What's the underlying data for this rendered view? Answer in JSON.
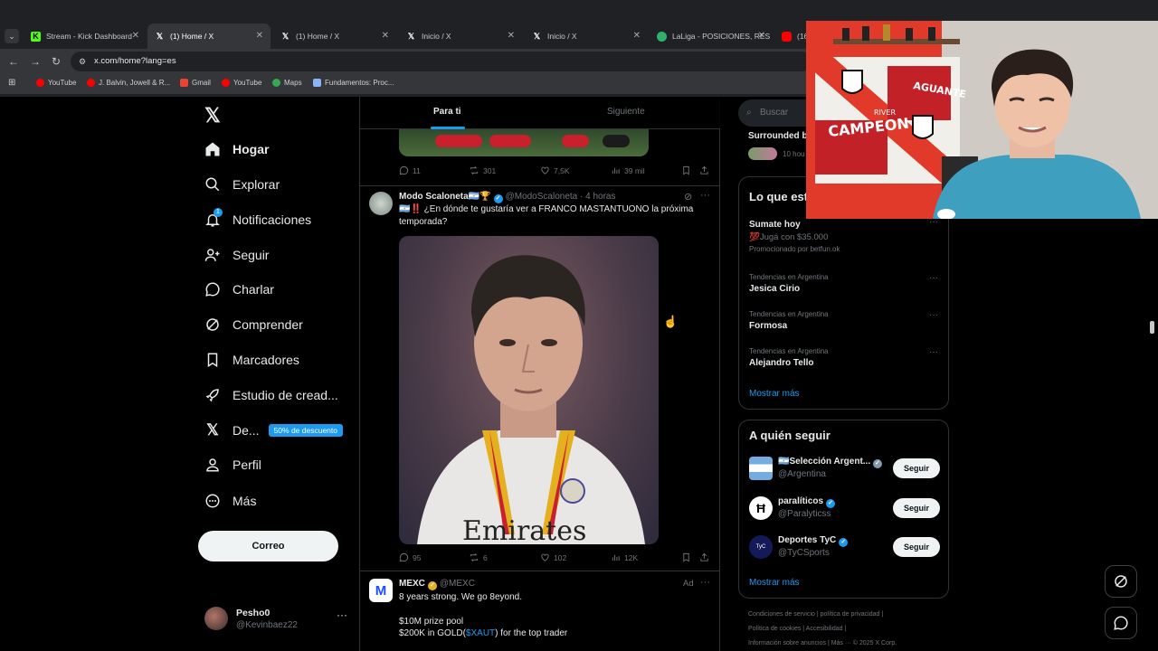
{
  "browser": {
    "tabs": [
      {
        "title": "Stream - Kick Dashboard",
        "icon": "kick-icon",
        "color": "#53fc18"
      },
      {
        "title": "(1) Home / X",
        "icon": "x-logo-icon",
        "color": "#ffffff",
        "active": true
      },
      {
        "title": "(1) Home / X",
        "icon": "x-logo-icon",
        "color": "#ffffff"
      },
      {
        "title": "Inicio / X",
        "icon": "x-logo-icon",
        "color": "#ffffff"
      },
      {
        "title": "Inicio / X",
        "icon": "x-logo-icon",
        "color": "#ffffff"
      },
      {
        "title": "LaLiga - POSICIONES, RES",
        "icon": "laliga-icon",
        "color": "#2fb36b"
      },
      {
        "title": "(16",
        "icon": "youtube-icon",
        "color": "#ff0000"
      }
    ],
    "url": "x.com/home?lang=es",
    "bookmarks": [
      {
        "label": "YouTube",
        "color": "#ff0000"
      },
      {
        "label": "J. Balvin, Jowell & R...",
        "color": "#ff0000"
      },
      {
        "label": "Gmail",
        "color": "#ea4335"
      },
      {
        "label": "YouTube",
        "color": "#ff0000"
      },
      {
        "label": "Maps",
        "color": "#34a853"
      },
      {
        "label": "Fundamentos: Proc...",
        "color": "#8ab4f8"
      }
    ]
  },
  "sidebar": {
    "items": [
      {
        "label": "Hogar",
        "icon": "home-icon"
      },
      {
        "label": "Explorar",
        "icon": "search-icon"
      },
      {
        "label": "Notificaciones",
        "icon": "bell-icon",
        "badge": "1"
      },
      {
        "label": "Seguir",
        "icon": "add-person-icon"
      },
      {
        "label": "Charlar",
        "icon": "chat-icon"
      },
      {
        "label": "Comprender",
        "icon": "grok-icon"
      },
      {
        "label": "Marcadores",
        "icon": "bookmark-icon"
      },
      {
        "label": "Estudio de cread...",
        "icon": "rocket-icon"
      },
      {
        "label": "De...",
        "icon": "x-logo-icon",
        "promo": "50% de descuento"
      },
      {
        "label": "Perfil",
        "icon": "person-icon"
      },
      {
        "label": "Más",
        "icon": "more-circle-icon"
      }
    ],
    "post_button": "Correo",
    "profile": {
      "name": "Pesho0",
      "handle": "@Kevinbaez22"
    }
  },
  "feed": {
    "tabs": [
      "Para ti",
      "Siguiente"
    ],
    "prev_tweet_stats": {
      "replies": "11",
      "reposts": "301",
      "likes": "7,5K",
      "views": "39 mil"
    },
    "tweet": {
      "name": "Modo Scaloneta🇦🇷🏆",
      "handle": "@ModoScaloneta",
      "time": "· 4 horas",
      "text_line1": "🇦🇷‼️ ¿En dónde te gustaría ver a FRANCO MASTANTUONO la próxima",
      "text_line2": "temporada?",
      "stats": {
        "replies": "95",
        "reposts": "6",
        "likes": "102",
        "views": "12K"
      }
    },
    "ad": {
      "name": "MEXC",
      "handle": "@MEXC",
      "ad_label": "Ad",
      "line1": "8 years strong. We go 8eyond.",
      "line2": "$10M prize pool",
      "line3a": "$200K in GOLD(",
      "line3_link": "$XAUT",
      "line3b": ") for the top trader"
    }
  },
  "right": {
    "search_placeholder": "Buscar",
    "surrounded": {
      "title": "Surrounded b",
      "sub": "10 hou"
    },
    "trends": {
      "title": "Lo que est",
      "promoted": {
        "name": "Sumate hoy",
        "line": "💯Jugá con $35.000",
        "by": "Promocionado por betfun.ok"
      },
      "items": [
        {
          "context": "Tendencias en Argentina",
          "name": "Jesica Cirio"
        },
        {
          "context": "Tendencias en Argentina",
          "name": "Formosa"
        },
        {
          "context": "Tendencias en Argentina",
          "name": "Alejandro Tello"
        }
      ],
      "show_more": "Mostrar más"
    },
    "who_to_follow": {
      "title": "A quién seguir",
      "accounts": [
        {
          "name": "🇦🇷Selección Argent...",
          "handle": "@Argentina",
          "button": "Seguir"
        },
        {
          "name": "paralíticos",
          "handle": "@Paralyticss",
          "button": "Seguir"
        },
        {
          "name": "Deportes TyC",
          "handle": "@TyCSports",
          "button": "Seguir"
        }
      ],
      "show_more": "Mostrar más"
    },
    "footer": {
      "line1": "Condiciones de servicio  |  política de privacidad  |",
      "line2": "Política de cookies  |  Accesibilidad  |",
      "line3": "Información sobre anuncios  |  Más ···  © 2025 X Corp."
    }
  },
  "webcam": {
    "flag_text1": "CAMPEON",
    "flag_text2": "RIVER",
    "flag_text3": "AGUANTE"
  }
}
